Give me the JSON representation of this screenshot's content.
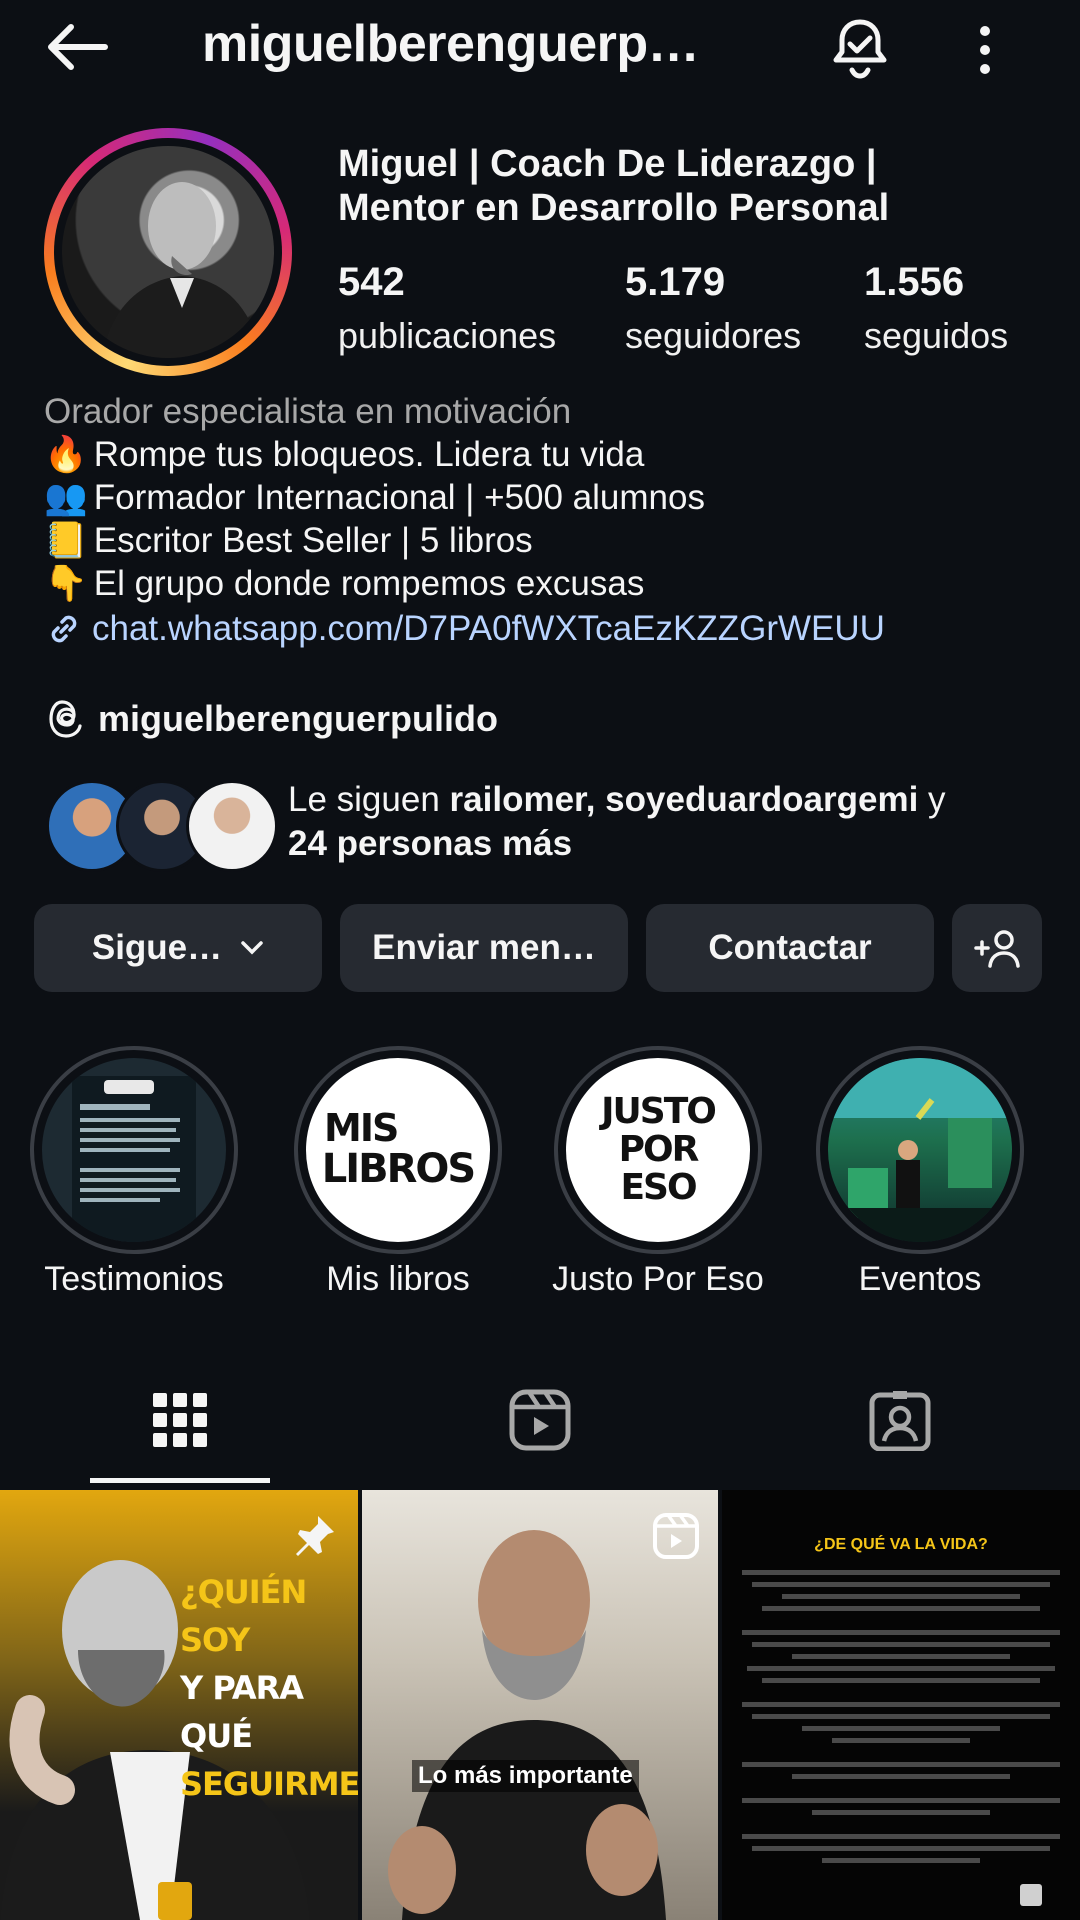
{
  "header": {
    "back_icon": "arrow-left-icon",
    "username": "miguelberenguerp…",
    "bell_icon": "bell-check-icon",
    "more_icon": "vertical-dots-icon"
  },
  "profile": {
    "name_line1": "Miguel | Coach De Liderazgo  |",
    "name_line2": "Mentor en Desarrollo Personal",
    "stats": [
      {
        "value": "542",
        "label": "publicaciones"
      },
      {
        "value": "5.179",
        "label": "seguidores"
      },
      {
        "value": "1.556",
        "label": "seguidos"
      }
    ],
    "category": "Orador especialista en motivación",
    "bio_lines": [
      {
        "emoji": "🔥",
        "text": "Rompe tus bloqueos. Lidera tu vida"
      },
      {
        "emoji": "👥",
        "text": "Formador Internacional | +500 alumnos"
      },
      {
        "emoji": "📒",
        "text": "Escritor Best Seller | 5 libros"
      },
      {
        "emoji": "👇",
        "text": "El grupo donde rompemos excusas"
      }
    ],
    "link": "chat.whatsapp.com/D7PA0fWXTcaEzKZZGrWEUU",
    "threads_handle": "miguelberenguerpulido",
    "mutual": {
      "prefix": "Le siguen ",
      "names": "railomer, soyeduardoargemi",
      "suffix": " y",
      "more": "24 personas más"
    }
  },
  "actions": {
    "following": "Sigue…",
    "message": "Enviar men…",
    "contact": "Contactar",
    "add_user_icon": "add-person-icon"
  },
  "highlights": [
    {
      "label": "Testimonios"
    },
    {
      "label": "Mis libros",
      "cover_text": [
        "MIS",
        "LIBROS"
      ]
    },
    {
      "label": "Justo Por Eso",
      "cover_text": [
        "JUSTO",
        "POR",
        "ESO"
      ]
    },
    {
      "label": "Eventos"
    }
  ],
  "tabs": [
    {
      "name": "grid",
      "icon": "grid-icon"
    },
    {
      "name": "reels",
      "icon": "reels-icon"
    },
    {
      "name": "tagged",
      "icon": "tagged-person-icon"
    }
  ],
  "posts": [
    {
      "title_line1": "¿QUIÉN SOY",
      "title_line2": "Y PARA QUÉ",
      "title_line3": "SEGUIRME?"
    },
    {
      "caption": "Lo más importante"
    },
    {
      "title": "¿DE QUÉ VA LA VIDA?"
    }
  ]
}
